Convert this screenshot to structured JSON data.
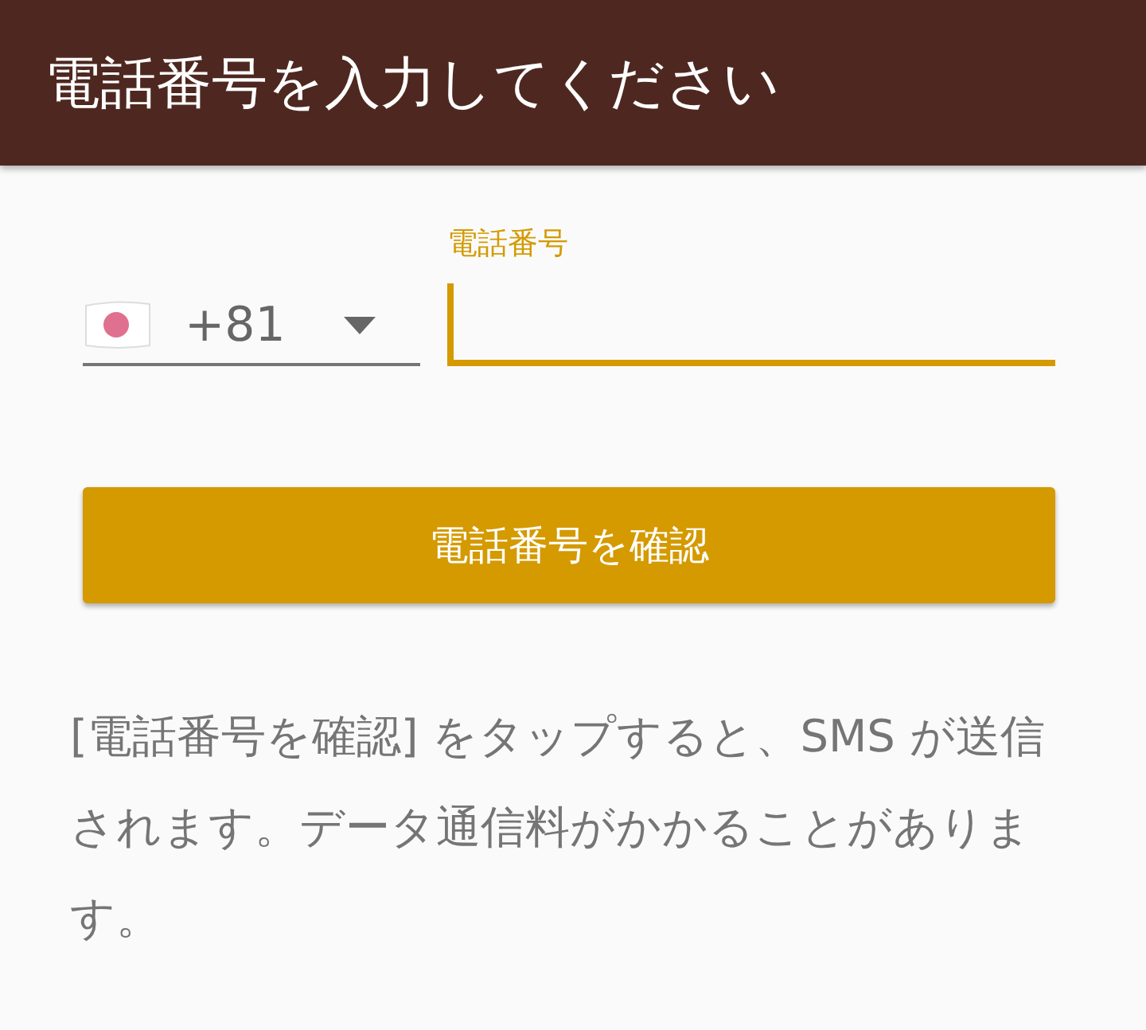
{
  "app_bar": {
    "title": "電話番号を入力してください"
  },
  "phone_form": {
    "country_code": "+81",
    "phone_field": {
      "label": "電話番号",
      "focused": true
    }
  },
  "verify_button": {
    "label": "電話番号を確認"
  },
  "notice": "[電話番号を確認] をタップすると、SMS が送信されます。データ通信料がかかることがあります。"
}
